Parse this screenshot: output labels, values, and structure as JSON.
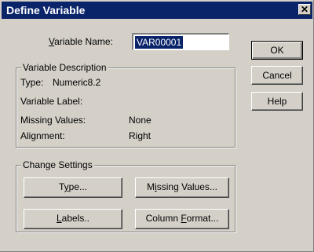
{
  "window": {
    "title": "Define Variable",
    "close_glyph": "✕"
  },
  "variable_name": {
    "label_pre": "",
    "label_accel": "V",
    "label_post": "ariable Name:",
    "value": "VAR00001"
  },
  "buttons": {
    "ok": "OK",
    "cancel": "Cancel",
    "help": "Help"
  },
  "description": {
    "legend": "Variable Description",
    "type_label": "Type:",
    "type_value": "Numeric8.2",
    "variable_label_label": "Variable Label:",
    "missing_label": "Missing Values:",
    "missing_value": "None",
    "alignment_label": "Alignment:",
    "alignment_value": "Right"
  },
  "settings": {
    "legend": "Change Settings",
    "type_btn": {
      "pre": "T",
      "accel": "y",
      "post": "pe..."
    },
    "missing_btn": {
      "pre": "M",
      "accel": "i",
      "post": "ssing Values..."
    },
    "labels_btn": {
      "pre": "",
      "accel": "L",
      "post": "abels.."
    },
    "column_btn": {
      "pre": "Column ",
      "accel": "F",
      "post": "ormat..."
    }
  }
}
